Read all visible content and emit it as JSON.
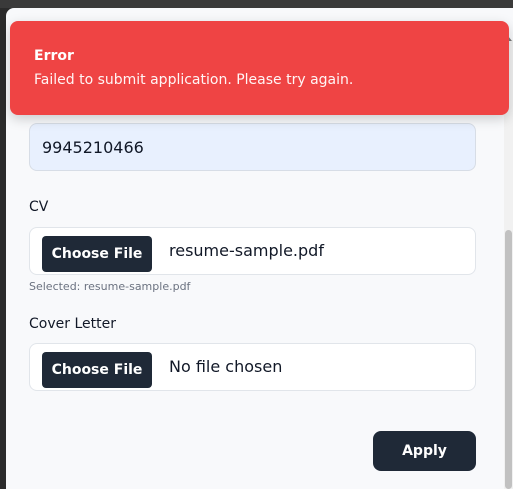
{
  "toast": {
    "title": "Error",
    "message": "Failed to submit application. Please try again.",
    "color": "#ef4444"
  },
  "phone": {
    "value": "9945210466"
  },
  "cv": {
    "label": "CV",
    "button_label": "Choose File",
    "file_name": "resume-sample.pdf",
    "helper": "Selected: resume-sample.pdf"
  },
  "cover_letter": {
    "label": "Cover Letter",
    "button_label": "Choose File",
    "file_name": "No file chosen"
  },
  "submit": {
    "label": "Apply",
    "color": "#1f2937"
  }
}
